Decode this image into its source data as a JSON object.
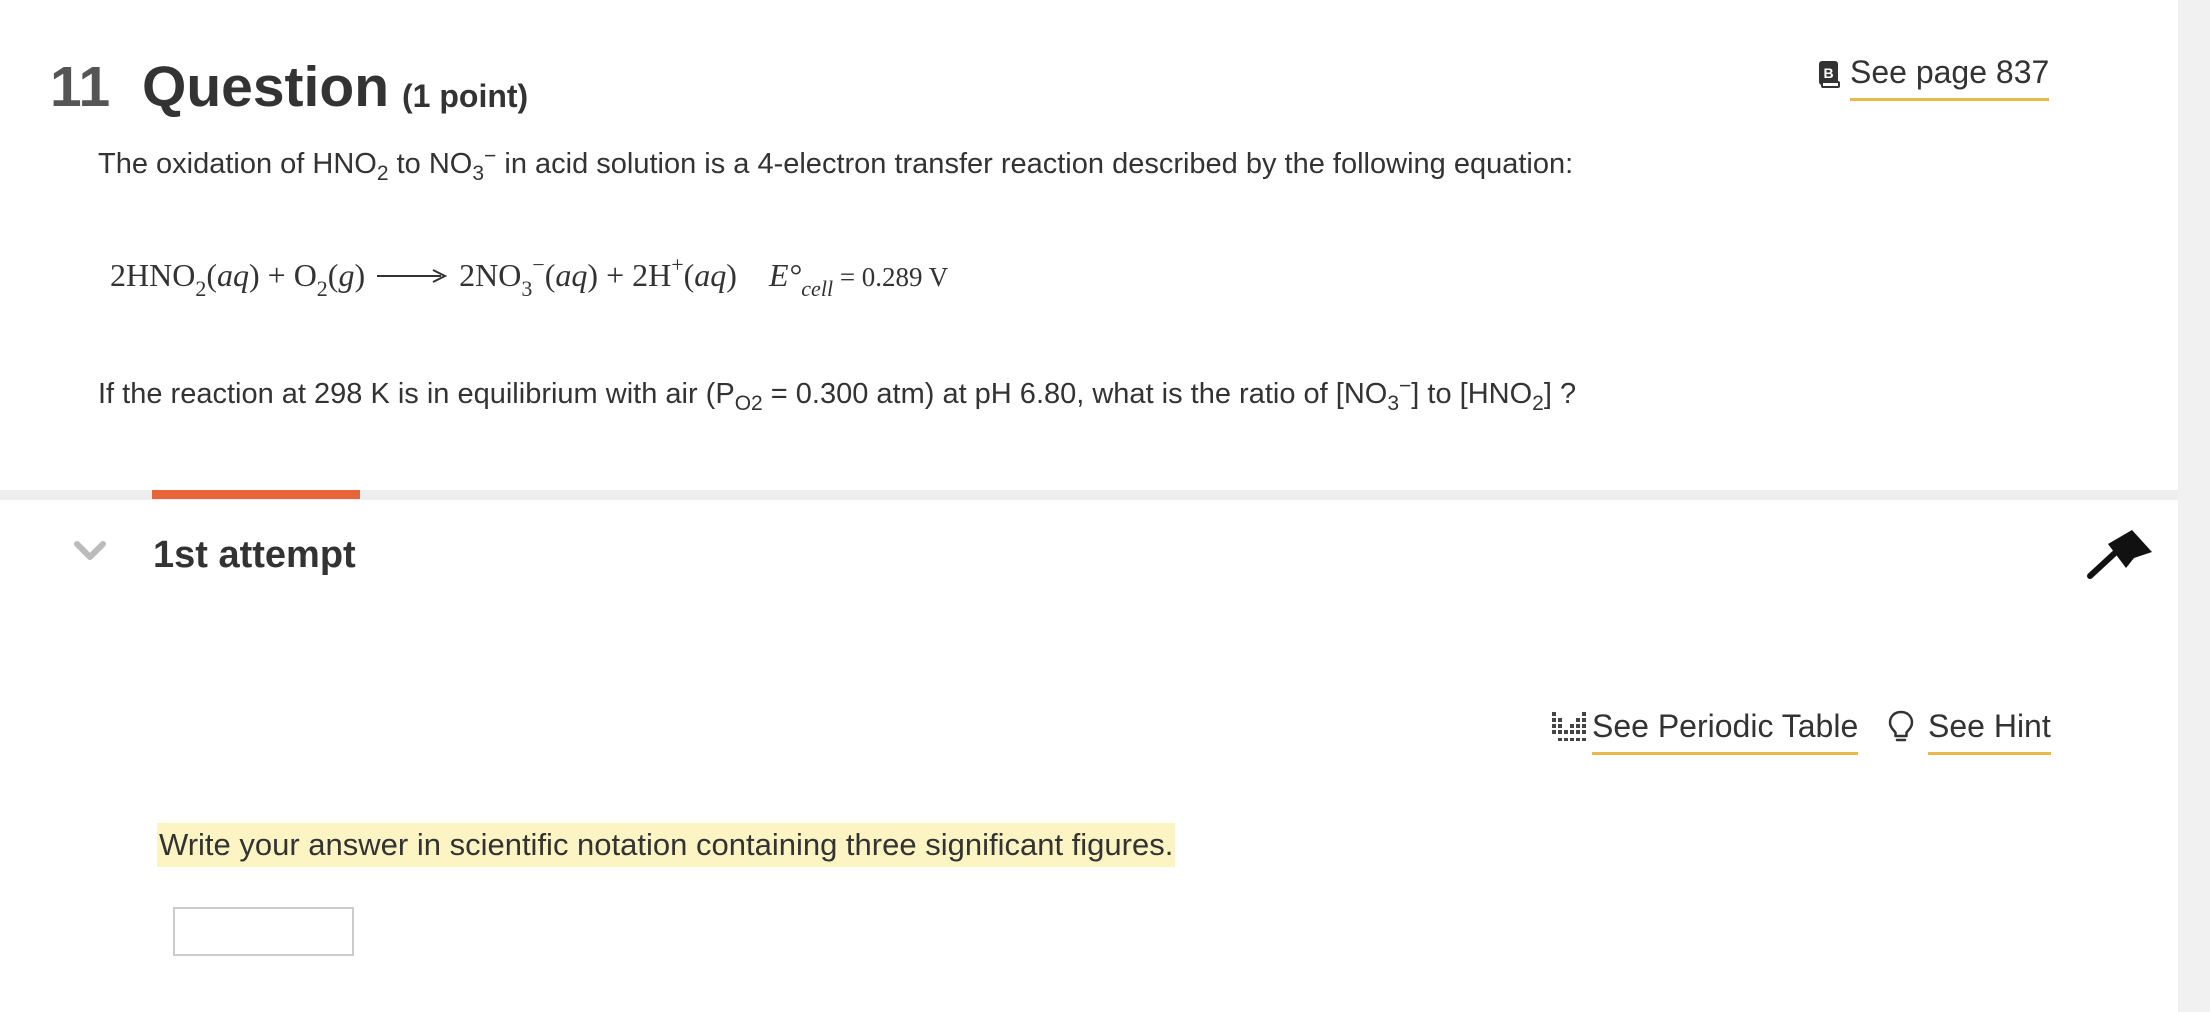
{
  "question": {
    "number": "11",
    "title": "Question",
    "points": "(1 point)",
    "see_page": "See page 837"
  },
  "intro": {
    "p1": "The oxidation of HNO",
    "s1": "2",
    "p2": " to NO",
    "s2": "3",
    "sup1": "−",
    "p3": " in acid solution is a 4-electron transfer reaction described by the following equation:"
  },
  "equation": {
    "c1": "2HNO",
    "s1": "2",
    "aq": "aq",
    "plus": " + ",
    "o": "O",
    "s2": "2",
    "g": "g",
    "c2": "2NO",
    "s3": "3",
    "sup_minus": "−",
    "c3": "2H",
    "sup_plus": "+",
    "e": "E°",
    "cell": "cell",
    "eq_value": " =  0.289 V"
  },
  "question_text": {
    "p1": "If the reaction at 298 K is in equilibrium with air (P",
    "s1": "O2",
    "p2": " = 0.300 atm) at pH 6.80, what is the ratio of [NO",
    "s2": "3",
    "sup": "−",
    "p3": "] to [HNO",
    "s3": "2",
    "p4": "] ?"
  },
  "attempt": {
    "title": "1st attempt",
    "periodic_table_label": "See Periodic Table",
    "hint_label": "See Hint",
    "instruction": "Write your answer in scientific notation containing three significant figures.",
    "answer_value": "",
    "answer_placeholder": ""
  },
  "colors": {
    "accent_underline": "#e8b84a",
    "attempt_accent": "#e8653c",
    "instruction_highlight": "#fdf4c4"
  },
  "icons": {
    "see_page": "book-icon",
    "collapse": "chevron-down-icon",
    "flag": "flag-icon",
    "periodic_table": "periodic-table-icon",
    "hint": "lightbulb-icon"
  }
}
